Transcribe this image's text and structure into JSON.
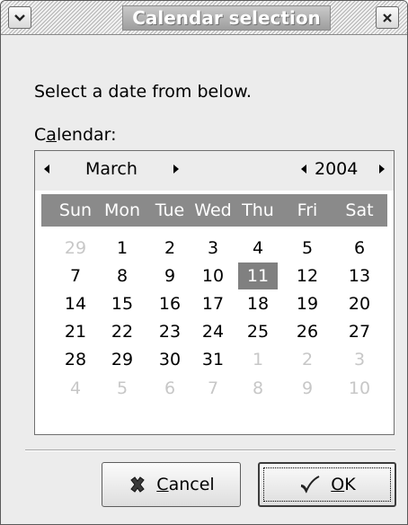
{
  "window": {
    "title": "Calendar selection"
  },
  "prompt": "Select a date from below.",
  "calendar_label": {
    "pre": "C",
    "mnemonic": "a",
    "post": "lendar:"
  },
  "calendar": {
    "month": "March",
    "year": "2004",
    "day_names": [
      "Sun",
      "Mon",
      "Tue",
      "Wed",
      "Thu",
      "Fri",
      "Sat"
    ],
    "weeks": [
      [
        {
          "d": "29",
          "o": true
        },
        {
          "d": "1"
        },
        {
          "d": "2"
        },
        {
          "d": "3"
        },
        {
          "d": "4"
        },
        {
          "d": "5"
        },
        {
          "d": "6"
        }
      ],
      [
        {
          "d": "7"
        },
        {
          "d": "8"
        },
        {
          "d": "9"
        },
        {
          "d": "10"
        },
        {
          "d": "11",
          "s": true
        },
        {
          "d": "12"
        },
        {
          "d": "13"
        }
      ],
      [
        {
          "d": "14"
        },
        {
          "d": "15"
        },
        {
          "d": "16"
        },
        {
          "d": "17"
        },
        {
          "d": "18"
        },
        {
          "d": "19"
        },
        {
          "d": "20"
        }
      ],
      [
        {
          "d": "21"
        },
        {
          "d": "22"
        },
        {
          "d": "23"
        },
        {
          "d": "24"
        },
        {
          "d": "25"
        },
        {
          "d": "26"
        },
        {
          "d": "27"
        }
      ],
      [
        {
          "d": "28"
        },
        {
          "d": "29"
        },
        {
          "d": "30"
        },
        {
          "d": "31"
        },
        {
          "d": "1",
          "o": true
        },
        {
          "d": "2",
          "o": true
        },
        {
          "d": "3",
          "o": true
        }
      ],
      [
        {
          "d": "4",
          "o": true
        },
        {
          "d": "5",
          "o": true
        },
        {
          "d": "6",
          "o": true
        },
        {
          "d": "7",
          "o": true
        },
        {
          "d": "8",
          "o": true
        },
        {
          "d": "9",
          "o": true
        },
        {
          "d": "10",
          "o": true
        }
      ]
    ]
  },
  "buttons": {
    "cancel": {
      "mnemonic": "C",
      "rest": "ancel",
      "icon": "cancel-x-icon"
    },
    "ok": {
      "mnemonic": "O",
      "rest": "K",
      "icon": "checkmark-icon"
    }
  },
  "colors": {
    "window_bg": "#ececec",
    "day_header_bg": "#8a8a8a",
    "selected_bg": "#808080",
    "other_month_text": "#c7c7c7"
  }
}
